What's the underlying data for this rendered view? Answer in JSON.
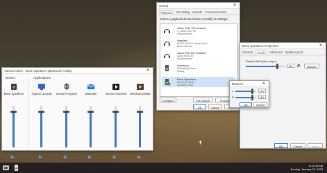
{
  "mixer": {
    "title": "Volume Mixer - Bose Speakers (Bluetooth Audio)",
    "device_header": "Device",
    "apps_header": "Applications",
    "device": {
      "label": "Bose Speakers",
      "level": 0.85
    },
    "apps": [
      {
        "label": "System Sounds",
        "level": 0.85,
        "icon": "system-sounds-icon"
      },
      {
        "label": "Mozart's Symphony #40 i...",
        "level": 0.85,
        "icon": "alienware-icon"
      },
      {
        "label": "BlueMail",
        "level": 0.85,
        "icon": "bluemail-icon"
      },
      {
        "label": "Movies Impossible Rog...",
        "level": 0.85,
        "icon": "movies-icon"
      },
      {
        "label": "Windows Media Player",
        "level": 0.85,
        "icon": "media-player-icon"
      }
    ]
  },
  "sound": {
    "title": "Sound",
    "tabs": [
      "Playback",
      "Recording",
      "Sounds",
      "Communications"
    ],
    "instruction": "Select a playback device below to modify its settings:",
    "devices": [
      {
        "name": "Jabra Elite 75t Earbuds",
        "sub": "2- Jabra Elite 75t",
        "status": "Disconnected"
      },
      {
        "name": "Headset",
        "sub": "BOSE QC35 II Hands-Free",
        "status": "Disconnected"
      },
      {
        "name": "Jabra Elite 65t Headset",
        "sub": "Jabra Elite 65t",
        "status": "Disconnected"
      },
      {
        "name": "Speakers",
        "sub": "Realtek(R) Audio",
        "status": "Ready"
      },
      {
        "name": "Bose Speakers",
        "sub": "Bluetooth Audio",
        "status": "Default Device"
      }
    ],
    "configure": "Configure",
    "set_default": "Set Default",
    "properties": "Properties",
    "ok": "OK",
    "cancel": "Cancel",
    "apply": "Apply"
  },
  "props": {
    "title": "Bose Speakers Properties",
    "tabs": [
      "General",
      "Levels",
      "Advanced",
      "Spatial sound"
    ],
    "output_label": "Realtek HD Audio output",
    "level_value": "80",
    "level_fraction": 0.8,
    "balance_button": "Balance",
    "ok": "OK",
    "cancel": "Cancel",
    "apply": "Apply"
  },
  "balance": {
    "title": "Balance",
    "left_label": "L",
    "right_label": "R",
    "left_value": "80",
    "right_value": "80",
    "left_fraction": 0.8,
    "right_fraction": 0.8,
    "ok": "OK",
    "cancel": "Cancel"
  },
  "taskbar": {
    "time": "8:12:43 AM",
    "date": "Sunday, January 22, 2023"
  }
}
